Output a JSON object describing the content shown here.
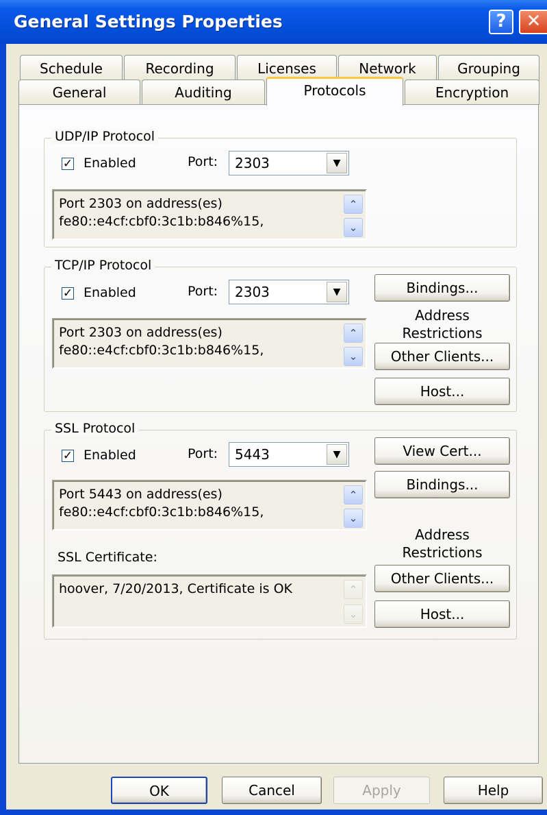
{
  "window": {
    "title": "General Settings Properties",
    "help_glyph": "?",
    "close_glyph": "✕"
  },
  "tabs": {
    "row1": [
      "Schedule",
      "Recording",
      "Licenses",
      "Network",
      "Grouping"
    ],
    "row2": [
      "General",
      "Auditing",
      "Protocols",
      "Encryption"
    ],
    "active": "Protocols"
  },
  "udp": {
    "label": "UDP/IP Protocol",
    "enabled_label": "Enabled",
    "enabled": true,
    "port_label": "Port:",
    "port": "2303",
    "info_line1": "Port 2303 on address(es)",
    "info_line2": "fe80::e4cf:cbf0:3c1b:b846%15,"
  },
  "tcp": {
    "label": "TCP/IP Protocol",
    "enabled_label": "Enabled",
    "enabled": true,
    "port_label": "Port:",
    "port": "2303",
    "info_line1": "Port 2303 on address(es)",
    "info_line2": "fe80::e4cf:cbf0:3c1b:b846%15,",
    "bindings_label": "Bindings...",
    "restrictions_line1": "Address",
    "restrictions_line2": "Restrictions",
    "other_clients_label": "Other Clients...",
    "host_label": "Host..."
  },
  "ssl": {
    "label": "SSL Protocol",
    "enabled_label": "Enabled",
    "enabled": true,
    "port_label": "Port:",
    "port": "5443",
    "info_line1": "Port 5443 on address(es)",
    "info_line2": "fe80::e4cf:cbf0:3c1b:b846%15,",
    "view_cert_label": "View Cert...",
    "bindings_label": "Bindings...",
    "restrictions_line1": "Address",
    "restrictions_line2": "Restrictions",
    "cert_label": "SSL Certificate:",
    "cert_value": "hoover, 7/20/2013, Certificate is OK",
    "other_clients_label": "Other Clients...",
    "host_label": "Host..."
  },
  "footer": {
    "ok": "OK",
    "cancel": "Cancel",
    "apply": "Apply",
    "help": "Help"
  },
  "glyphs": {
    "check": "✓",
    "arrow_down": "▼",
    "scroll_up": "⌃",
    "scroll_down": "⌄"
  },
  "colors": {
    "titlebar": "#0450dc",
    "dialog_bg": "#ece9d8",
    "active_tab_accent": "#ffc83c"
  }
}
